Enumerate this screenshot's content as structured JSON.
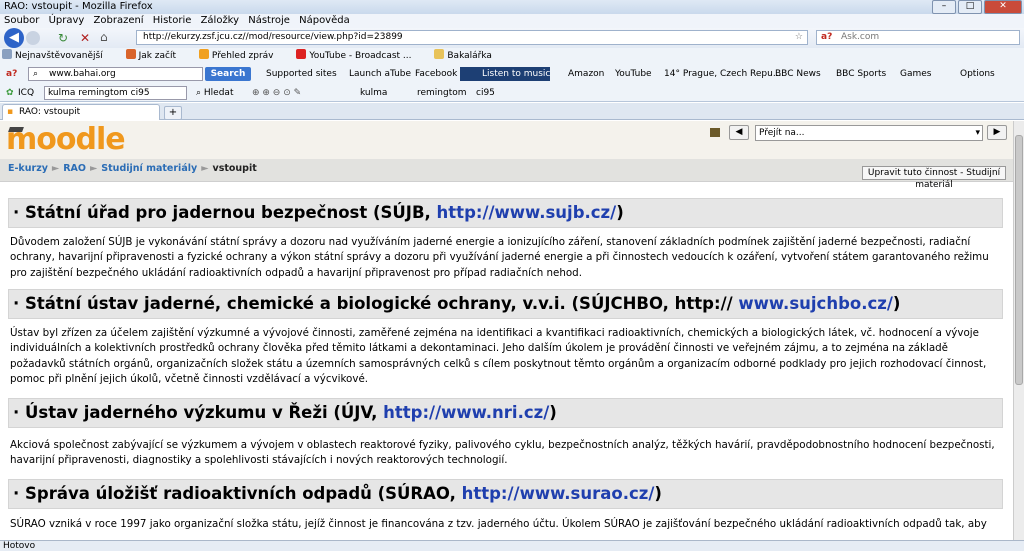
{
  "window": {
    "title": "RAO: vstoupit - Mozilla Firefox"
  },
  "menu": [
    "Soubor",
    "Úpravy",
    "Zobrazení",
    "Historie",
    "Záložky",
    "Nástroje",
    "Nápověda"
  ],
  "nav": {
    "url": "http://ekurzy.zsf.jcu.cz//mod/resource/view.php?id=23899",
    "search_placeholder": "Ask.com"
  },
  "bookmarks": [
    "Nejnavštěvovanější",
    "Jak začít",
    "Přehled zpráv",
    "YouTube - Broadcast ...",
    "Bakalářka"
  ],
  "askbar": {
    "query": "www.bahai.org",
    "search_label": "Search",
    "items": [
      "Supported sites",
      "Launch aTube",
      "Facebook",
      "Amazon",
      "YouTube",
      "14° Prague, Czech Repu...",
      "BBC News",
      "BBC Sports",
      "Games",
      "Options"
    ],
    "listen_label": "Listen to music"
  },
  "toolbar3": {
    "brand": "ICQ",
    "query": "kulma remingtom ci95",
    "find_label": "Hledat",
    "words": [
      "kulma",
      "remingtom",
      "ci95"
    ]
  },
  "tab": {
    "label": "RAO: vstoupit"
  },
  "moodle": {
    "logo": "moodle",
    "jump_placeholder": "Přejít na...",
    "breadcrumb": [
      "E-kurzy",
      "RAO",
      "Studijní materiály",
      "vstoupit"
    ],
    "edit_button": "Upravit tuto činnost - Studijní materiál"
  },
  "sections": [
    {
      "heading": "Státní úřad pro jadernou bezpečnost (SÚJB, ",
      "link": "http://www.sujb.cz/",
      "tail": ")",
      "text": "Důvodem založení SÚJB je vykonávání státní správy a dozoru nad využíváním jaderné energie a ionizujícího záření, stanovení základních podmínek zajištění jaderné bezpečnosti, radiační ochrany, havarijní připravenosti a fyzické ochrany a výkon státní správy a dozoru při využívání jaderné energie a při činnostech vedoucích k ozáření, vytvoření státem garantovaného režimu pro zajištění bezpečného ukládání radioaktivních odpadů a havarijní připravenost pro případ radiačních nehod."
    },
    {
      "heading": "Státní ústav jaderné, chemické a biologické ochrany, v.v.i. (SÚJCHBO, http:// ",
      "link": "www.sujchbo.cz/",
      "tail": ")",
      "text": "Ústav byl zřízen za účelem zajištění výzkumné a vývojové činnosti, zaměřené zejména na identifikaci a kvantifikaci radioaktivních, chemických a biologických látek, vč. hodnocení a vývoje individuálních a kolektivních prostředků ochrany člověka před těmito látkami a dekontaminaci. Jeho dalším úkolem je provádění činnosti ve veřejném zájmu, a to zejména na základě požadavků státních orgánů, organizačních složek státu a územních samosprávných celků s cílem poskytnout těmto orgánům a organizacím odborné podklady pro jejich rozhodovací činnost, pomoc při plnění jejich úkolů, včetně činnosti vzdělávací a výcvikové."
    },
    {
      "heading": "Ústav jaderného výzkumu v Řeži (ÚJV, ",
      "link": "http://www.nri.cz/",
      "tail": ")",
      "text": "Akciová společnost zabývající se výzkumem a vývojem v oblastech reaktorové fyziky, palivového cyklu, bezpečnostních analýz, těžkých havárií, pravděpodobnostního hodnocení bezpečnosti, havarijní připravenosti, diagnostiky a spolehlivosti stávajících i nových reaktorových technologií."
    },
    {
      "heading": "Správa úložišť radioaktivních odpadů (SÚRAO, ",
      "link": "http://www.surao.cz/",
      "tail": ")",
      "text": "SÚRAO vzniká v roce 1997 jako organizační složka státu, jejíž činnost je financována z tzv. jaderného účtu. Úkolem SÚRAO je zajišťování bezpečného ukládání radioaktivních odpadů tak, aby"
    }
  ],
  "status": "Hotovo"
}
